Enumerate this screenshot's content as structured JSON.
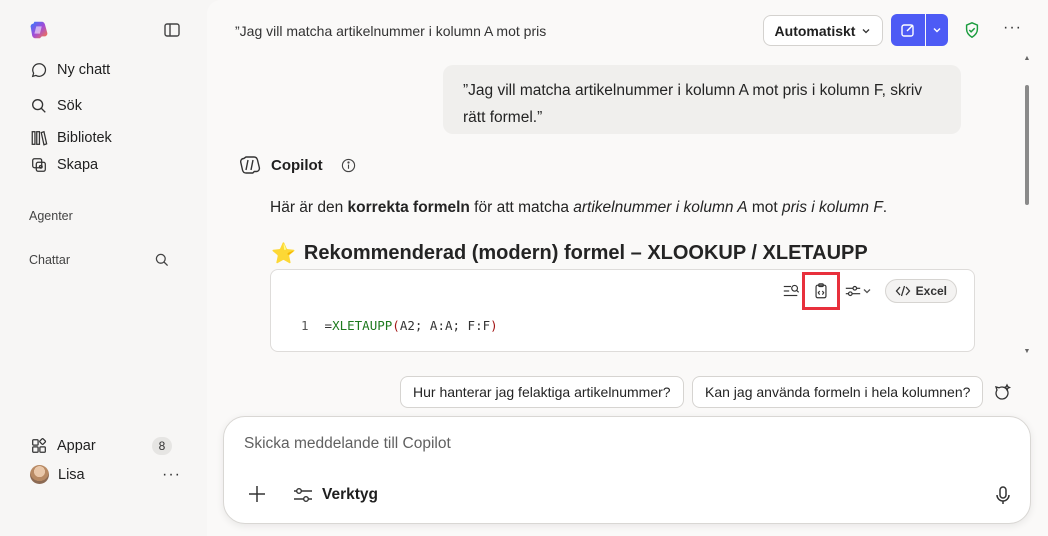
{
  "sidebar": {
    "nav": [
      {
        "label": "Ny chatt",
        "icon": "chat-icon"
      },
      {
        "label": "Sök",
        "icon": "search-icon"
      },
      {
        "label": "Bibliotek",
        "icon": "library-icon"
      },
      {
        "label": "Skapa",
        "icon": "create-icon"
      }
    ],
    "sections": {
      "agents": "Agenter",
      "chats": "Chattar"
    },
    "apps": {
      "label": "Appar",
      "count": "8"
    },
    "user": {
      "name": "Lisa"
    }
  },
  "header": {
    "title": "”Jag vill matcha artikelnummer i kolumn A mot pris",
    "mode": "Automatiskt"
  },
  "conversation": {
    "user_message": "”Jag vill matcha artikelnummer i kolumn A mot pris i kolumn F, skriv rätt formel.”",
    "assistant_name": "Copilot",
    "answer": {
      "p1": "Här är den ",
      "p2": "korrekta formeln",
      "p3": " för att matcha ",
      "p4": "artikelnummer i kolumn A",
      "p5": " mot ",
      "p6": "pris i kolumn F",
      "p7": "."
    },
    "heading": {
      "emoji": "⭐",
      "text": "Rekommenderad (modern) formel – XLOOKUP / XLETAUPP"
    },
    "code": {
      "language": "Excel",
      "line_number": "1",
      "eq": "=",
      "fn": "XLETAUPP",
      "open": "(",
      "args": "A2; A:A; F:F",
      "close": ")"
    }
  },
  "suggestions": [
    "Hur hanterar jag felaktiga artikelnummer?",
    "Kan jag använda formeln i hela kolumnen?"
  ],
  "composer": {
    "placeholder": "Skicka meddelande till Copilot",
    "tools_label": "Verktyg"
  },
  "colors": {
    "accent": "#4d5bf5",
    "highlight": "#e8303c",
    "shield": "#1a9c3e"
  }
}
